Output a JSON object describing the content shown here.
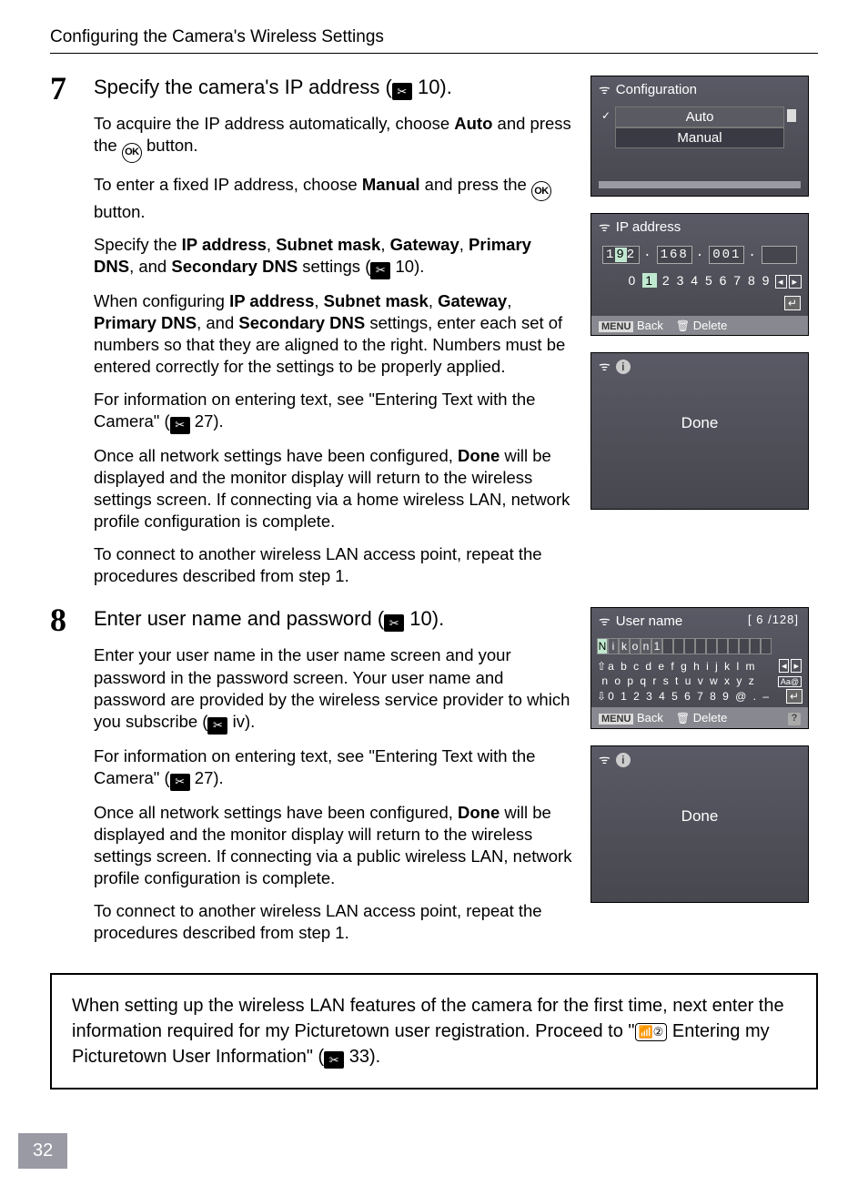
{
  "header": "Configuring the Camera's Wireless Settings",
  "page_number": "32",
  "step7": {
    "num": "7",
    "title_a": "Specify the camera's IP address (",
    "title_b": " 10).",
    "p1a": "To acquire the IP address automatically, choose ",
    "p1b": "Auto",
    "p1c": " and press the ",
    "p1d": " button.",
    "p2a": "To enter a fixed IP address, choose ",
    "p2b": "Manual",
    "p2c": " and press the ",
    "p2d": " button.",
    "p3a": "Specify the ",
    "p3b": "IP address",
    "p3c": ", ",
    "p3d": "Subnet mask",
    "p3e": ", ",
    "p3f": "Gateway",
    "p3g": ", ",
    "p3h": "Primary DNS",
    "p3i": ", and ",
    "p3j": "Secondary DNS",
    "p3k": " settings (",
    "p3l": " 10).",
    "p4a": "When configuring ",
    "p4b": "IP address",
    "p4c": ", ",
    "p4d": "Subnet mask",
    "p4e": ", ",
    "p4f": "Gateway",
    "p4g": ", ",
    "p4h": "Primary DNS",
    "p4i": ", and ",
    "p4j": "Secondary DNS",
    "p4k": " settings, enter each set of numbers so that they are aligned to the right. Numbers must be entered correctly for the settings to be properly applied.",
    "p5a": "For information on entering text, see \"Entering Text with the Camera\" (",
    "p5b": " 27).",
    "p6a": "Once all network settings have been configured, ",
    "p6b": "Done",
    "p6c": " will be displayed and the monitor display will return to the wireless settings screen. If connecting via a home wireless LAN, network profile configuration is complete.",
    "p7": "To connect to another wireless LAN access point, repeat the procedures described from step 1."
  },
  "step8": {
    "num": "8",
    "title_a": "Enter user name and password (",
    "title_b": " 10).",
    "p1a": "Enter your user name in the user name screen and your password in the password screen. Your user name and password are provided by the wireless service provider to which you subscribe (",
    "p1b": " iv).",
    "p2a": "For information on entering text, see \"Entering Text with the Camera\" (",
    "p2b": " 27).",
    "p3a": "Once all network settings have been configured, ",
    "p3b": "Done",
    "p3c": " will be displayed and the monitor display will return to the wireless settings screen. If connecting via a public wireless LAN, network profile configuration is complete.",
    "p4": "To connect to another wireless LAN access point, repeat the procedures described from step 1."
  },
  "note": {
    "a": "When setting up the wireless LAN features of the camera for the first time, next enter the information required for my Picturetown user registration. Proceed to \"",
    "b": " Entering my Picturetown User Information\" (",
    "c": " 33)."
  },
  "screens": {
    "config": {
      "title": "Configuration",
      "opt1": "Auto",
      "opt2": "Manual"
    },
    "ip": {
      "title": "IP address",
      "seg1a": "1",
      "seg1b": "9",
      "seg1c": "2",
      "dot": ".",
      "seg2": "168",
      "seg3": "001",
      "numbers": "0 1 2 3 4 5 6 7 8 9",
      "back": "Back",
      "delete": "Delete",
      "menu": "MENU"
    },
    "done": {
      "text": "Done"
    },
    "username": {
      "title": "User name",
      "counter": "[    6 /128]",
      "value": "Nikon1",
      "row1": "a b c d e f g h i j k l m",
      "row2": "n o p q r s t u v w x y z",
      "row3": "0 1 2 3 4 5 6 7 8 9 @ . –",
      "back": "Back",
      "delete": "Delete",
      "menu": "MENU"
    }
  },
  "icons": {
    "wrench": "✄",
    "ok": "OK",
    "antenna": "⟐",
    "circle2": "②"
  }
}
